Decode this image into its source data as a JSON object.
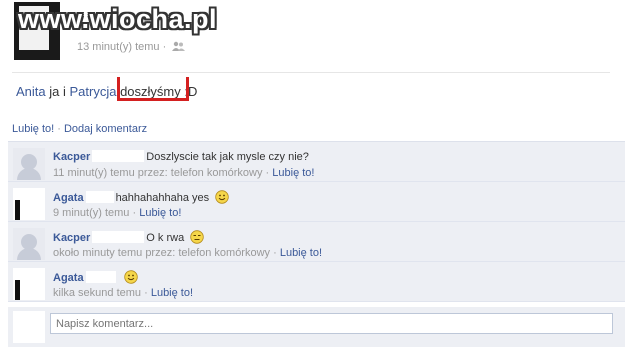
{
  "watermark": "www.wiocha.pl",
  "post": {
    "time": "13 minut(y) temu",
    "text": {
      "author": "Anita",
      "part1": " ja i ",
      "mention": "Patrycja",
      "space": " ",
      "highlight": "doszłyśmy",
      "end": " :D"
    },
    "actions": {
      "like": "Lubię to!",
      "separator": " · ",
      "comment": "Dodaj komentarz"
    }
  },
  "comments": [
    {
      "author": "Kacper",
      "text": "Doszlyscie tak jak mysle czy nie?",
      "time": "11 minut(y) temu przez: telefon komórkowy",
      "like": "Lubię to!",
      "emoji": ""
    },
    {
      "author": "Agata",
      "text": "hahhahahhaha yes",
      "time": "9 minut(y) temu",
      "like": "Lubię to!",
      "emoji": "smile"
    },
    {
      "author": "Kacper",
      "text": "O k rwa",
      "time": "około minuty temu przez: telefon komórkowy",
      "like": "Lubię to!",
      "emoji": "unamused"
    },
    {
      "author": "Agata",
      "text": "",
      "time": "kilka sekund temu",
      "like": "Lubię to!",
      "emoji": "smile"
    }
  ],
  "write_comment": {
    "placeholder": "Napisz komentarz..."
  },
  "colors": {
    "link": "#3b5998",
    "comment_bg": "#edeff4",
    "red_mark": "#d42020"
  }
}
